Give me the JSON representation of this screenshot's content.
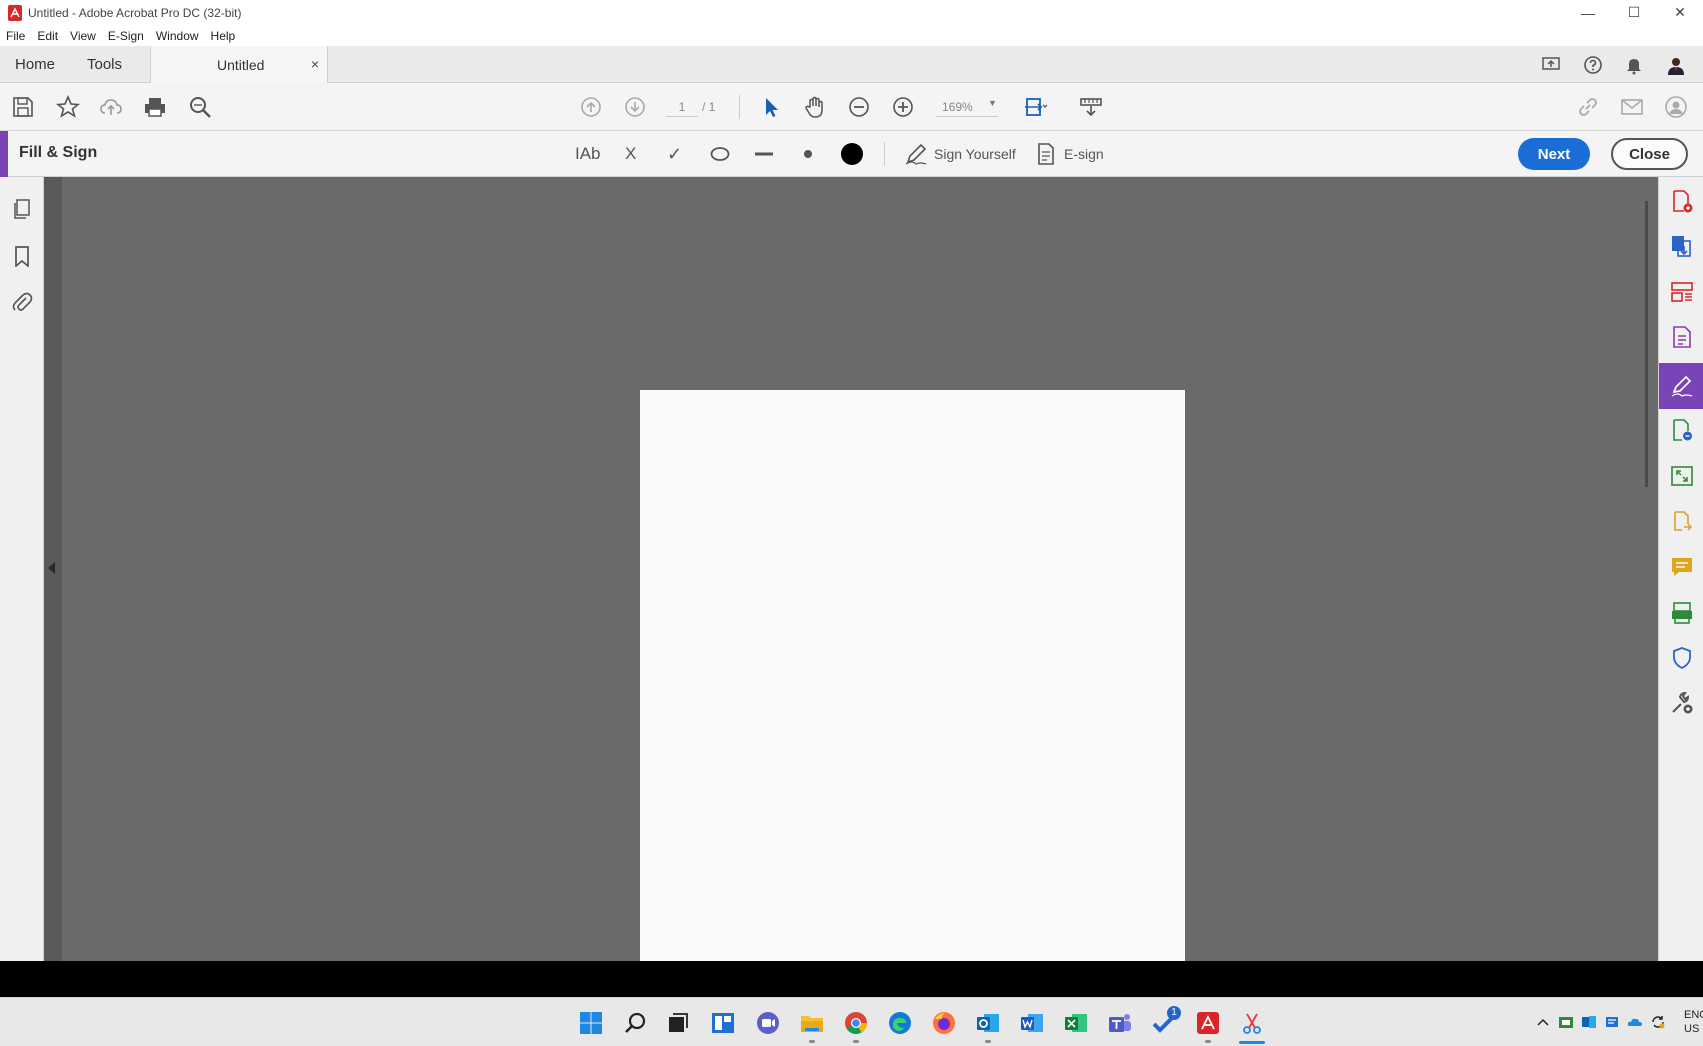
{
  "window": {
    "title": "Untitled - Adobe Acrobat Pro DC (32-bit)",
    "minimize_glyph": "—",
    "maximize_glyph": "☐",
    "close_glyph": "✕"
  },
  "menu": [
    "File",
    "Edit",
    "View",
    "E-Sign",
    "Window",
    "Help"
  ],
  "tabs": {
    "home": "Home",
    "tools": "Tools",
    "document": "Untitled",
    "document_close": "×"
  },
  "toolbar": {
    "current_page": "1",
    "page_total": "/ 1",
    "zoom": "169%"
  },
  "fill_sign": {
    "title": "Fill & Sign",
    "text_tool": "IAb",
    "cross_tool": "X",
    "check_tool": "✓",
    "sign_yourself": "Sign Yourself",
    "esign": "E-sign",
    "next": "Next",
    "close": "Close"
  },
  "colors": {
    "accent_purple": "#7a43b6",
    "next_blue": "#1a6dd5",
    "doc_background": "#6a6a6a",
    "page": "#fafafa"
  },
  "taskbar": {
    "language": "ENG",
    "region": "US",
    "teams_badge": "1"
  }
}
